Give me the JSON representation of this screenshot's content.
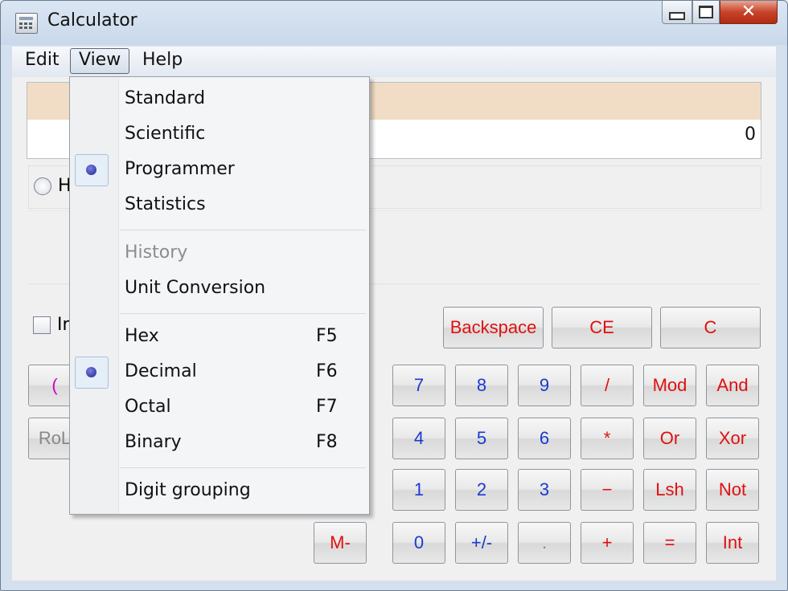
{
  "window": {
    "title": "Calculator",
    "icon": "calculator-icon"
  },
  "menubar": {
    "items": [
      "Edit",
      "View",
      "Help"
    ]
  },
  "display": {
    "value": "0"
  },
  "radix": {
    "label": "H"
  },
  "checkbox": {
    "label": "In"
  },
  "buttons": {
    "backspace": "Backspace",
    "ce": "CE",
    "c": "C",
    "paren": "(",
    "rol": "RoL",
    "n7": "7",
    "n8": "8",
    "n9": "9",
    "div": "/",
    "mod": "Mod",
    "and": "And",
    "n4": "4",
    "n5": "5",
    "n6": "6",
    "mul": "*",
    "or": "Or",
    "xor": "Xor",
    "n1": "1",
    "n2": "2",
    "n3": "3",
    "sub": "−",
    "lsh": "Lsh",
    "not": "Not",
    "mminus": "M-",
    "n0": "0",
    "neg": "+/-",
    "dot": ".",
    "add": "+",
    "eq": "=",
    "int": "Int"
  },
  "view_menu": {
    "modes": [
      "Standard",
      "Scientific",
      "Programmer",
      "Statistics"
    ],
    "selected_mode": "Programmer",
    "history": "History",
    "unit_conversion": "Unit Conversion",
    "bases": [
      {
        "label": "Hex",
        "key": "F5"
      },
      {
        "label": "Decimal",
        "key": "F6"
      },
      {
        "label": "Octal",
        "key": "F7"
      },
      {
        "label": "Binary",
        "key": "F8"
      }
    ],
    "selected_base": "Decimal",
    "digit_grouping": "Digit grouping"
  },
  "colors": {
    "digit": "#1a3ad0",
    "operator": "#e01010",
    "paren": "#d000c8",
    "history_band": "#f1ddc6"
  }
}
